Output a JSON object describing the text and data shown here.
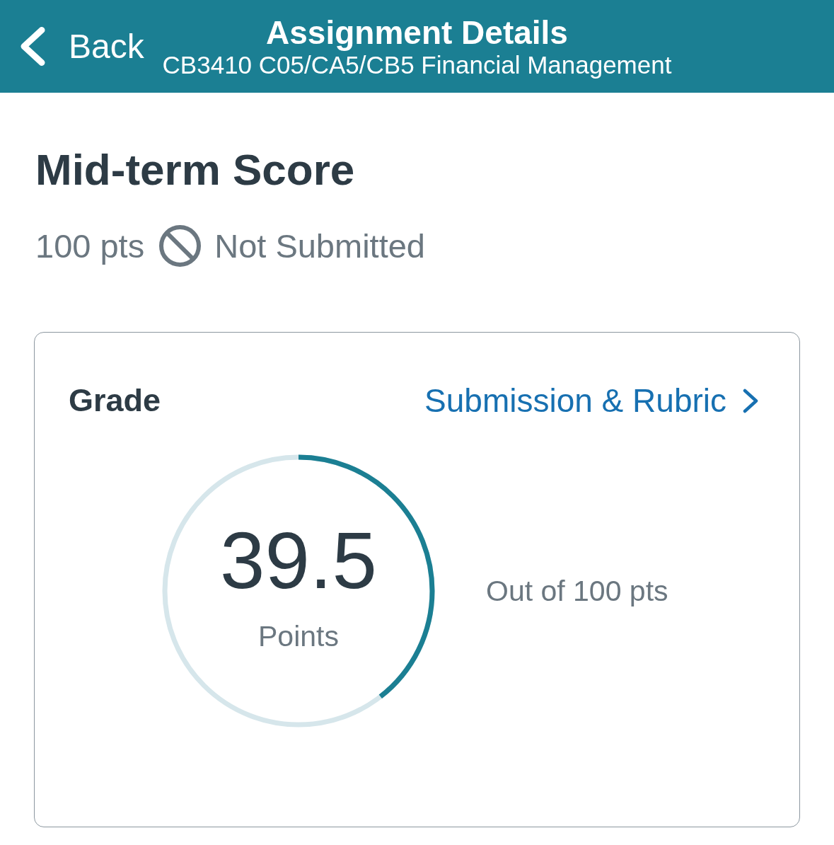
{
  "header": {
    "back_label": "Back",
    "title": "Assignment Details",
    "subtitle": "CB3410 C05/CA5/CB5 Financial Management"
  },
  "assignment": {
    "title": "Mid-term Score",
    "points": "100 pts",
    "submitted": false,
    "status": "Not Submitted"
  },
  "grade_card": {
    "heading": "Grade",
    "link": "Submission & Rubric",
    "score": "39.5",
    "score_unit": "Points",
    "level": 0.395,
    "out_of": "Out of 100 pts"
  }
}
